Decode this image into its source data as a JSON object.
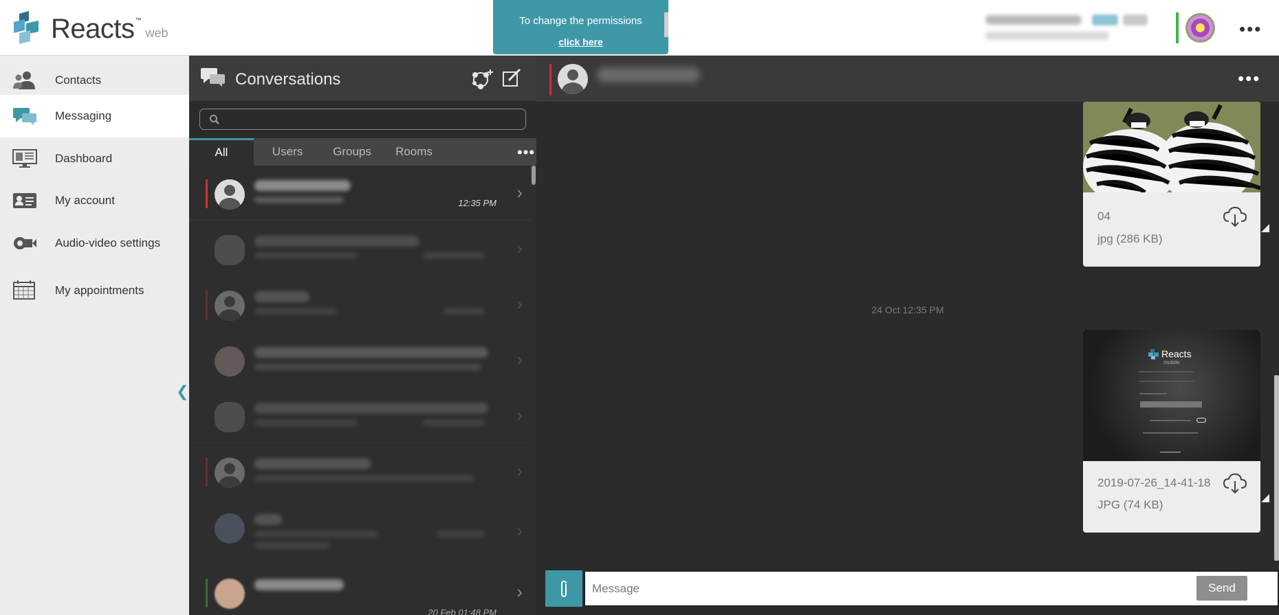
{
  "brand": {
    "name": "Reacts",
    "tm": "™",
    "suffix": "web"
  },
  "permission_banner": {
    "line1": "To change the permissions",
    "link": "click here"
  },
  "nav": {
    "items": [
      {
        "label": "Contacts",
        "icon": "contacts-icon"
      },
      {
        "label": "Messaging",
        "icon": "messaging-icon",
        "active": true
      },
      {
        "label": "Dashboard",
        "icon": "dashboard-icon"
      },
      {
        "label": "My account",
        "icon": "account-card-icon"
      },
      {
        "label": "Audio-video settings",
        "icon": "audio-video-settings-icon"
      },
      {
        "label": "My appointments",
        "icon": "calendar-icon"
      }
    ],
    "collapse_glyph": "❮"
  },
  "conversations": {
    "title": "Conversations",
    "search": {
      "placeholder": "",
      "value": ""
    },
    "tabs": [
      "All",
      "Users",
      "Groups",
      "Rooms"
    ],
    "active_tab": "All",
    "more_glyph": "•••",
    "rows": [
      {
        "time": "12:35 PM",
        "flag": "#d12f2f"
      },
      {
        "time": "",
        "flag": ""
      },
      {
        "time": "",
        "flag": "#d12f2f"
      },
      {
        "time": "",
        "flag": ""
      },
      {
        "time": "",
        "flag": ""
      },
      {
        "time": "",
        "flag": "#d12f2f"
      },
      {
        "time": "",
        "flag": ""
      },
      {
        "time": "20 Feb 01:48 PM",
        "flag": "#3db34a"
      }
    ]
  },
  "chat": {
    "more_glyph": "•••",
    "date_separator": "24 Oct 12:35 PM",
    "attachments": [
      {
        "name": "04",
        "size": "jpg (286 KB)"
      },
      {
        "name": "2019-07-26_14-41-18",
        "size": "JPG (74 KB)"
      }
    ],
    "thumbnail_text": {
      "brand": "Reacts",
      "sub": "mobile"
    },
    "composer": {
      "placeholder": "Message",
      "send_label": "Send"
    }
  },
  "colors": {
    "accent": "#3f98a8",
    "presence_online": "#3db34a",
    "presence_busy": "#d12f2f"
  },
  "top_more_glyph": "•••"
}
